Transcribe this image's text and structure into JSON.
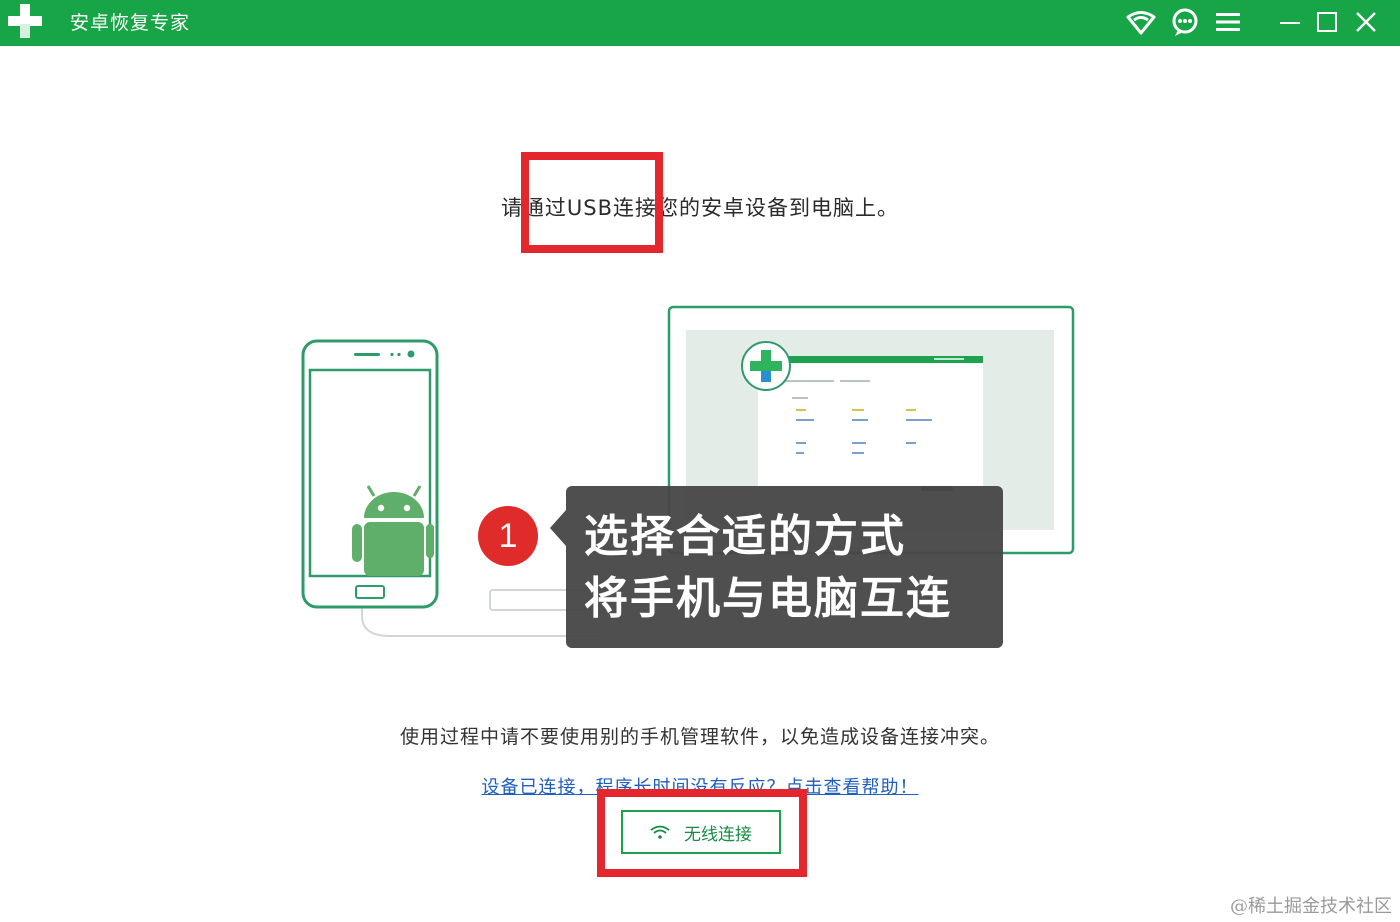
{
  "app": {
    "title": "安卓恢复专家",
    "brand_color": "#18a547"
  },
  "titlebar": {
    "icons": [
      "wifi-icon",
      "chat-icon",
      "menu-icon",
      "minimize-icon",
      "maximize-icon",
      "close-icon"
    ]
  },
  "main": {
    "instruction": "请通过USB连接您的安卓设备到电脑上。",
    "callout": {
      "step": "1",
      "line1": "选择合适的方式",
      "line2": "将手机与电脑互连"
    },
    "notice": "使用过程中请不要使用别的手机管理软件，以免造成设备连接冲突。",
    "help_link": "设备已连接，程序长时间没有反应？点击查看帮助！",
    "wireless_button": "无线连接"
  },
  "watermark": "@稀土掘金技术社区",
  "colors": {
    "highlight_red": "#e4262d",
    "link_blue": "#1f5fbf"
  }
}
